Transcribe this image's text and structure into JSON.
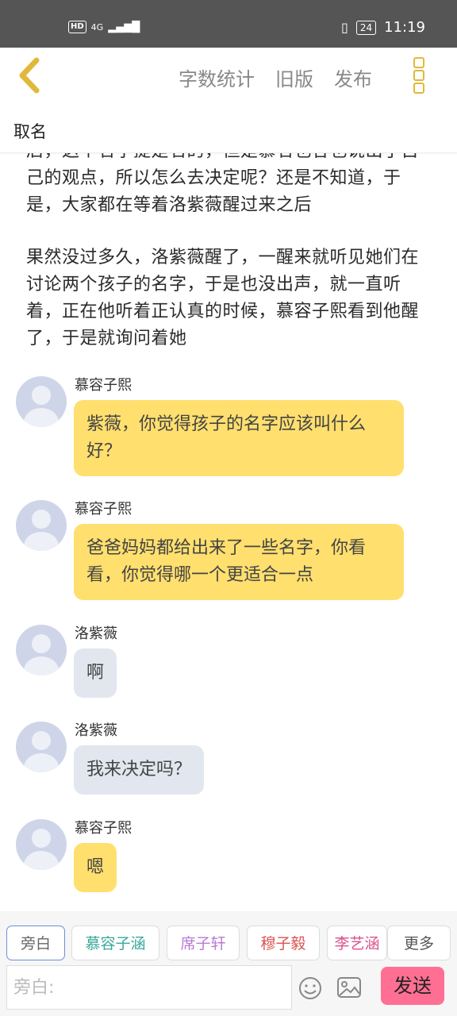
{
  "status_bar": {
    "hd": "HD",
    "signal": "4G",
    "battery": "24",
    "time": "11:19"
  },
  "top_bar": {
    "actions": [
      "字数统计",
      "旧版",
      "发布"
    ]
  },
  "chapter_title": "取名",
  "narration": [
    "后，这个名字提是名的，但是慕名也各也说出了自己的观点，所以怎么去决定呢？还是不知道，于是，大家都在等着洛紫薇醒过来之后",
    "果然没过多久，洛紫薇醒了，一醒来就听见她们在讨论两个孩子的名字，于是也没出声，就一直听着，正在他听着正认真的时候，慕容子熙看到他醒了，于是就询问着她"
  ],
  "messages": [
    {
      "name": "慕容子熙",
      "text": "紫薇，你觉得孩子的名字应该叫什么好？"
    },
    {
      "name": "慕容子熙",
      "text": "爸爸妈妈都给出来了一些名字，你看看，你觉得哪一个更适合一点"
    },
    {
      "name": "洛紫薇",
      "text": "啊"
    },
    {
      "name": "洛紫薇",
      "text": "我来决定吗？"
    },
    {
      "name": "慕容子熙",
      "text": "嗯"
    }
  ],
  "character_tags": [
    "旁白",
    "慕容子涵",
    "席子轩",
    "穆子毅",
    "李艺涵",
    "更多"
  ],
  "tag_colors": [
    "#666666",
    "#3aa79a",
    "#b77ad6",
    "#d9534f",
    "#d9538f",
    "#555555"
  ],
  "input": {
    "placeholder": "旁白:"
  },
  "send_label": "发送",
  "colors": {
    "accent_yellow": "#ffdf6e",
    "bubble_grey": "#e1e6ef",
    "send_pink": "#ff6f93",
    "status_bar": "#555555"
  }
}
